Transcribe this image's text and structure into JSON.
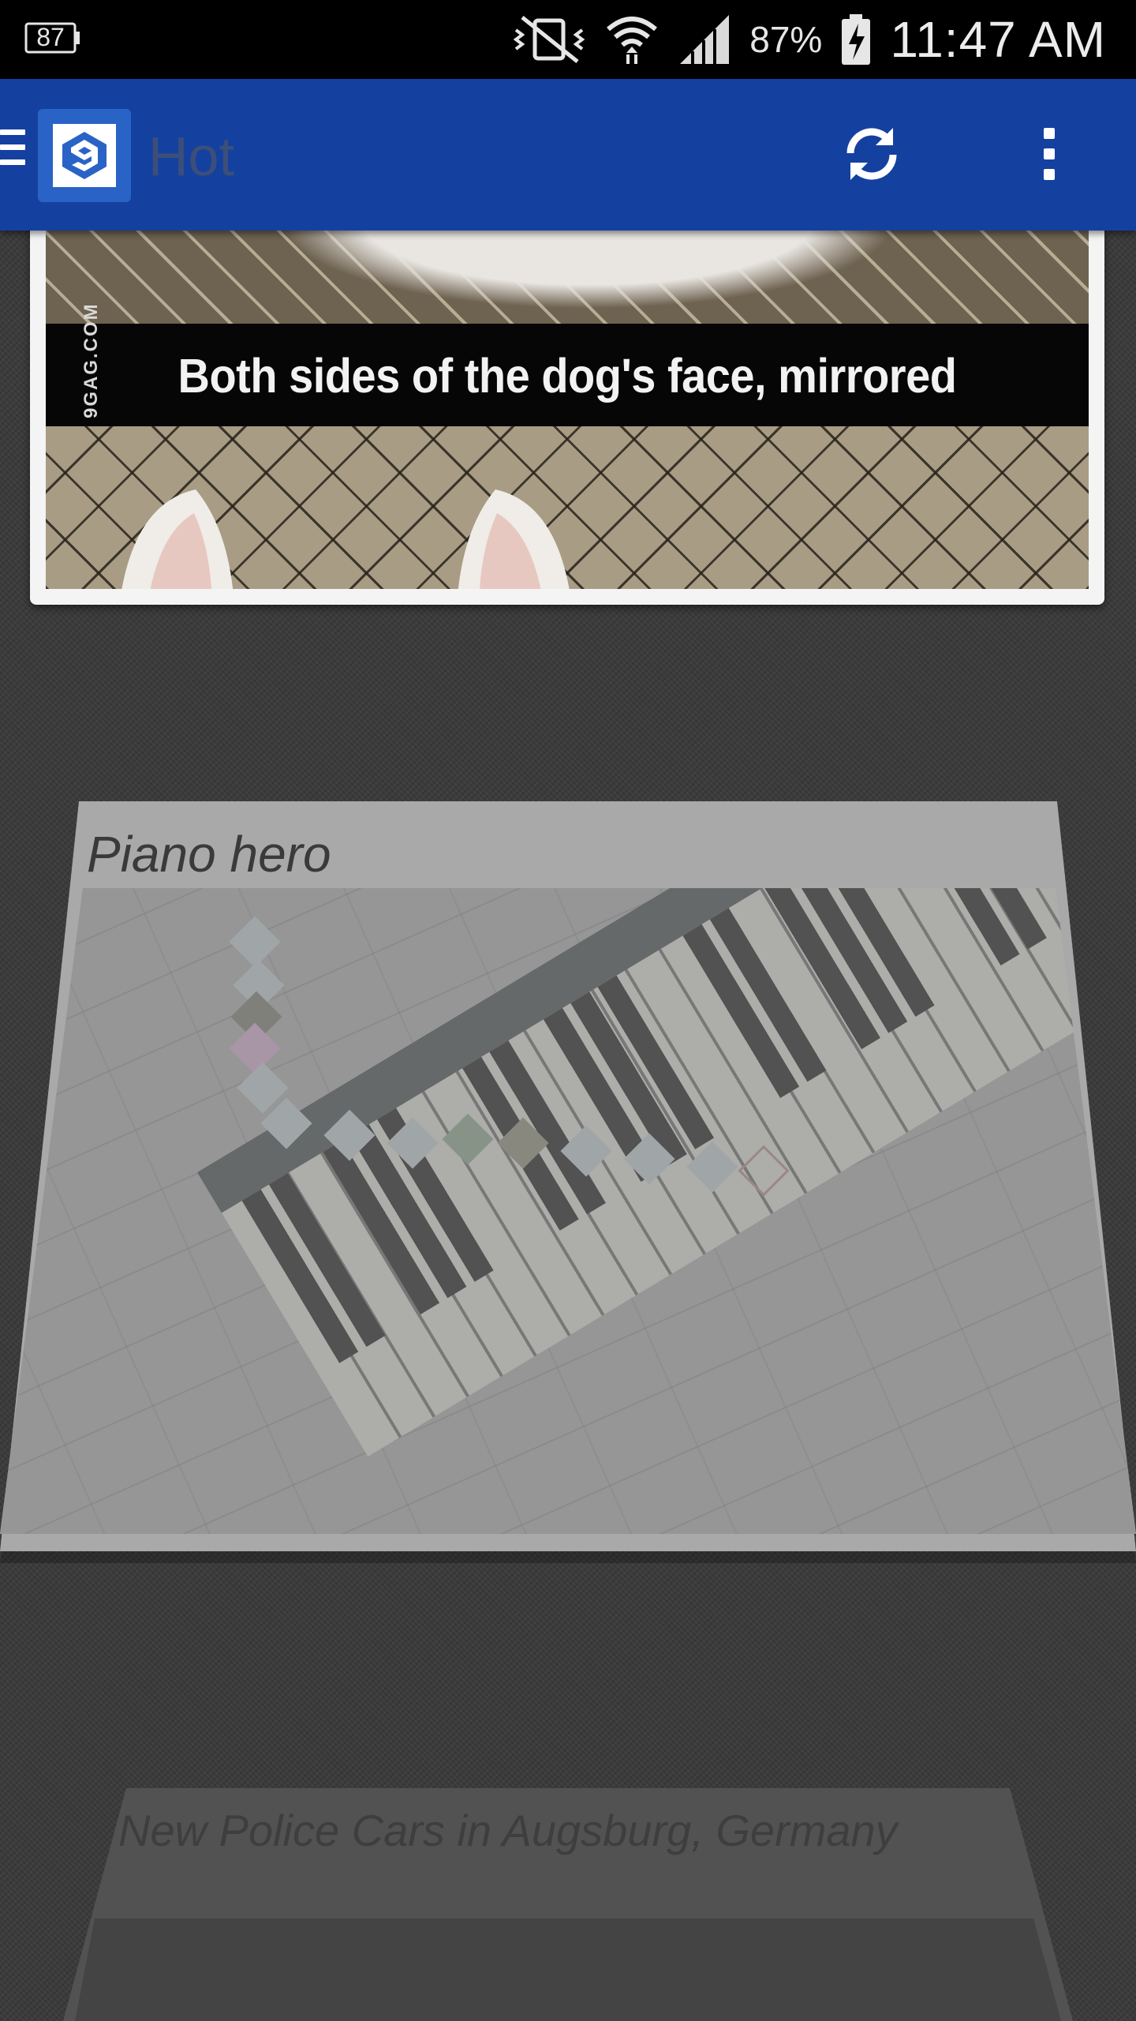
{
  "status_bar": {
    "notification_badge": "87",
    "battery_percent": "87%",
    "time": "11:47 AM",
    "icons": [
      "battery-notification-icon",
      "mute-vibrate-icon",
      "wifi-icon",
      "signal-icon",
      "battery-charging-icon"
    ]
  },
  "app_bar": {
    "title": "Hot",
    "logo_glyph": "9",
    "icons": [
      "menu-icon",
      "app-logo-icon",
      "refresh-icon",
      "more-options-icon"
    ],
    "color": "#1441a0"
  },
  "posts": [
    {
      "image_caption": "Both sides of the dog's face, mirrored",
      "watermark": "9GAG.COM"
    },
    {
      "title": "Piano hero"
    },
    {
      "title": "New Police Cars in Augsburg, Germany"
    }
  ]
}
